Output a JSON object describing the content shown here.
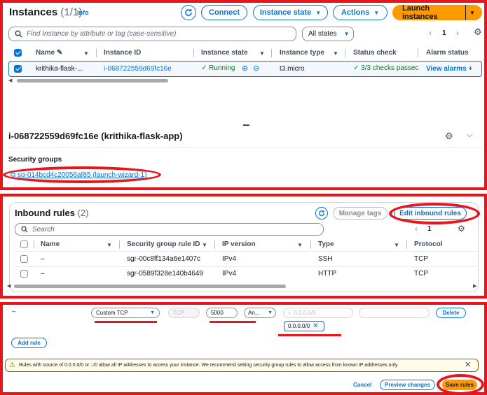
{
  "instances": {
    "title": "Instances",
    "count": "(1/1)",
    "info": "Info",
    "buttons": {
      "connect": "Connect",
      "instance_state": "Instance state",
      "actions": "Actions",
      "launch": "Launch instances"
    },
    "search_placeholder": "Find Instance by attribute or tag (case-sensitive)",
    "states_filter": "All states",
    "page": "1",
    "columns": [
      "Name",
      "Instance ID",
      "Instance state",
      "Instance type",
      "Status check",
      "Alarm status"
    ],
    "row": {
      "name": "krithika-flask-...",
      "id": "i-068722559d69fc16e",
      "state": "Running",
      "type": "t3.micro",
      "status": "3/3 checks passec",
      "alarm": "View alarms"
    }
  },
  "details": {
    "title": "i-068722559d69fc16e (krithika-flask-app)",
    "sg_label": "Security groups",
    "sg_link": "sg-014bcd4c20056af85 (launch-wizard-1)"
  },
  "inbound": {
    "title": "Inbound rules",
    "count": "(2)",
    "manage_tags": "Manage tags",
    "edit": "Edit inbound rules",
    "search_placeholder": "Search",
    "page": "1",
    "columns": [
      "Name",
      "Security group rule ID",
      "IP version",
      "Type",
      "Protocol"
    ],
    "rows": [
      {
        "name": "–",
        "id": "sgr-00c8ff134a6e1407c",
        "ipv": "IPv4",
        "type": "SSH",
        "proto": "TCP"
      },
      {
        "name": "–",
        "id": "sgr-0589f328e140b4649",
        "ipv": "IPv4",
        "type": "HTTP",
        "proto": "TCP"
      }
    ]
  },
  "edit_rule": {
    "dash": "–",
    "type": "Custom TCP",
    "protocol": "TCP",
    "port": "5000",
    "source": "An...",
    "cidr_placeholder": "0.0.0.0/0",
    "cidr_token": "0.0.0.0/0",
    "delete": "Delete",
    "add_rule": "Add rule",
    "warning": "Rules with source of 0.0.0.0/0 or ::/0 allow all IP addresses to access your instance. We recommend setting security group rules to allow access from known IP addresses only.",
    "cancel": "Cancel",
    "preview": "Preview changes",
    "save": "Save rules"
  },
  "colors": {
    "accent": "#0972d3",
    "orange": "#ff9900",
    "annotation_red": "#e8151b",
    "success": "#037f0c"
  }
}
